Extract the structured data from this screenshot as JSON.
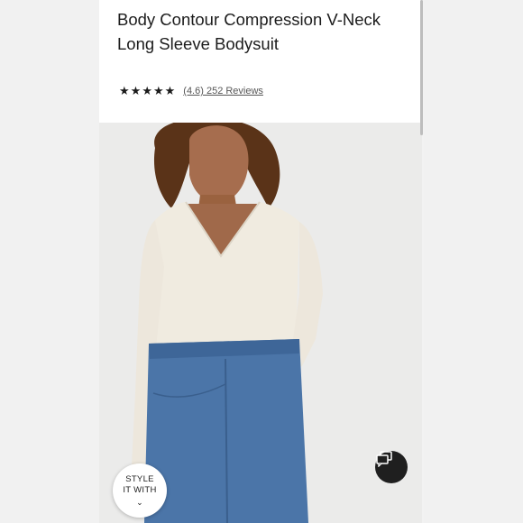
{
  "product": {
    "title": "Body Contour Compression V-Neck Long Sleeve Bodysuit",
    "rating": {
      "stars": 4.6,
      "max_stars": 5,
      "text": "(4.6) 252 Reviews"
    }
  },
  "buttons": {
    "style_line1": "STYLE",
    "style_line2": "IT WITH",
    "style_chevron": "⌄",
    "chat_icon": "chat-bubbles-icon"
  },
  "colors": {
    "bodysuit": "#f0ebe0",
    "denim": "#4b75a8",
    "skin": "#a0694a",
    "hair": "#5a3318"
  }
}
